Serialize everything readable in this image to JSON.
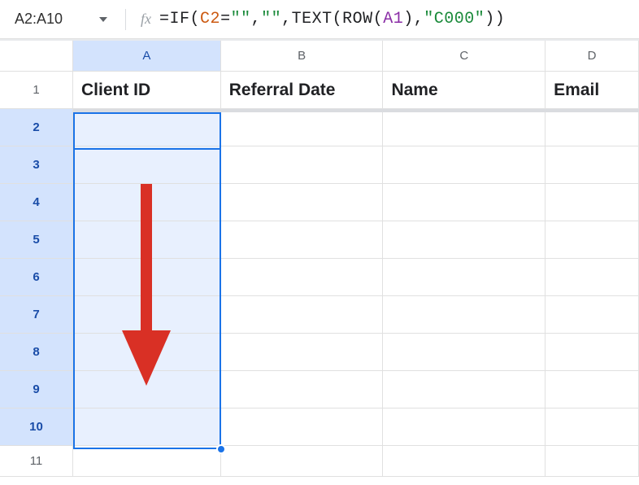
{
  "name_box": "A2:A10",
  "formula": {
    "raw": "=IF(C2=\"\",\"\",TEXT(ROW(A1),\"C000\"))",
    "tokens": {
      "eq": "=",
      "if": "IF",
      "open1": "(",
      "c2": "C2",
      "eqop": "=",
      "empty1": "\"\"",
      "sep1": ",",
      "empty2": "\"\"",
      "sep2": ",",
      "text": "TEXT",
      "open2": "(",
      "rowfn": "ROW",
      "open3": "(",
      "a1": "A1",
      "close3": ")",
      "sep3": ",",
      "c000": "\"C000\"",
      "close2": ")",
      "close1": ")"
    }
  },
  "columns": [
    {
      "id": "A",
      "label": "A",
      "header": "Client ID",
      "selected": true
    },
    {
      "id": "B",
      "label": "B",
      "header": "Referral Date",
      "selected": false
    },
    {
      "id": "C",
      "label": "C",
      "header": "Name",
      "selected": false
    },
    {
      "id": "D",
      "label": "D",
      "header": "Email",
      "selected": false
    }
  ],
  "rows": [
    {
      "n": "1",
      "selected": false
    },
    {
      "n": "2",
      "selected": true
    },
    {
      "n": "3",
      "selected": true
    },
    {
      "n": "4",
      "selected": true
    },
    {
      "n": "5",
      "selected": true
    },
    {
      "n": "6",
      "selected": true
    },
    {
      "n": "7",
      "selected": true
    },
    {
      "n": "8",
      "selected": true
    },
    {
      "n": "9",
      "selected": true
    },
    {
      "n": "10",
      "selected": true
    },
    {
      "n": "11",
      "selected": false
    }
  ],
  "selection": {
    "range": "A2:A10",
    "active": "A2"
  },
  "colors": {
    "accent": "#1a73e8",
    "arrow": "#d93025"
  }
}
